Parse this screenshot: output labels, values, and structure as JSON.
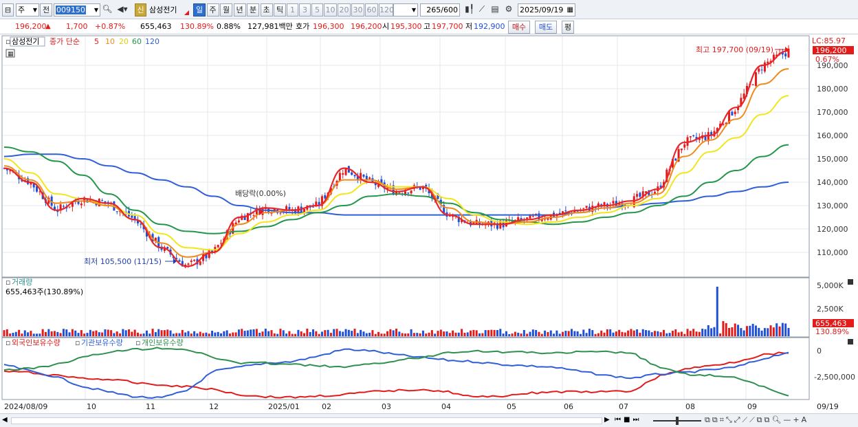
{
  "toolbar": {
    "market_type": "주",
    "prev_label": "전",
    "code": "009150",
    "badge_new": "신",
    "stock_name": "삼성전기",
    "periods": [
      "일",
      "주",
      "월",
      "년",
      "분",
      "초",
      "틱"
    ],
    "active_period": "일",
    "intervals": [
      "1",
      "3",
      "5",
      "10",
      "20",
      "30",
      "60",
      "120"
    ],
    "count": "265",
    "count_max": "/600",
    "date": "2025/09/19"
  },
  "quote": {
    "price": "196,200",
    "arrow": "▲",
    "change": "1,700",
    "change_pct": "+0.87%",
    "volume": "655,463",
    "volume_ratio": "130.89%",
    "turnover": "0.88%",
    "amount": "127,981백만",
    "bid_label": "호가",
    "bid1": "196,300",
    "bid2": "196,200",
    "open_label": "시",
    "open": "195,300",
    "high_label": "고",
    "high": "197,700",
    "low_label": "저",
    "low": "192,900",
    "buy_label": "매수",
    "sell_label": "매도",
    "avg_label": "평"
  },
  "price_panel": {
    "legend_name": "삼성전기",
    "legend_title": "종가 단순",
    "ma_periods": [
      "5",
      "10",
      "20",
      "60",
      "120"
    ],
    "ma_colors": [
      "#e8262a",
      "#f08a1c",
      "#f2e51a",
      "#23964a",
      "#2f5fd8"
    ],
    "lc_label": "LC:85.97",
    "last_price_tag": "196,200",
    "last_pct_tag": "0.67%",
    "high_annotation": "최고 197,700 (09/19)",
    "low_annotation": "최저 105,500 (11/15)",
    "dividend_annotation": "배당락(0.00%)",
    "y_ticks": [
      "190,000",
      "180,000",
      "170,000",
      "160,000",
      "150,000",
      "140,000",
      "130,000",
      "120,000",
      "110,000"
    ]
  },
  "volume_panel": {
    "title": "거래량",
    "current": "655,463주(130.89%)",
    "y_ticks": [
      "5,000K",
      "2,500K"
    ],
    "last_tag": "655,463",
    "ratio_tag": "130.89%"
  },
  "holding_panel": {
    "legends": [
      "외국인보유수량",
      "기관보유수량",
      "개인보유수량"
    ],
    "colors": [
      "#e21b1b",
      "#2f5fd8",
      "#2f8f4e"
    ],
    "y_ticks": [
      "0",
      "-2,500,000"
    ]
  },
  "x_axis": {
    "labels": [
      "2024/08/09",
      "10",
      "11",
      "12",
      "2025/01",
      "02",
      "03",
      "04",
      "05",
      "06",
      "07",
      "08",
      "09"
    ],
    "right_label": "09/19"
  },
  "chart_data": {
    "type": "line",
    "title": "삼성전기",
    "price_ylim": [
      100000,
      200000
    ],
    "months": [
      "2024/08/09",
      "10",
      "11",
      "12",
      "2025/01",
      "02",
      "03",
      "04",
      "05",
      "06",
      "07",
      "08",
      "09",
      "09/19"
    ],
    "series": [
      {
        "name": "5",
        "values": [
          146000,
          140000,
          128000,
          133000,
          131000,
          124000,
          112000,
          104000,
          110000,
          125000,
          129000,
          128000,
          130000,
          146000,
          140000,
          136000,
          138000,
          126000,
          122000,
          122000,
          124000,
          126000,
          128000,
          130000,
          132000,
          137000,
          157000,
          160000,
          172000,
          190000,
          196200
        ]
      },
      {
        "name": "10",
        "values": [
          147000,
          141000,
          131000,
          132000,
          130000,
          124000,
          114000,
          108000,
          110000,
          122000,
          127000,
          128000,
          130000,
          141000,
          141000,
          137000,
          138000,
          129000,
          123000,
          122000,
          123000,
          125000,
          127000,
          129000,
          131000,
          135000,
          151000,
          158000,
          167000,
          182000,
          188500
        ]
      },
      {
        "name": "20",
        "values": [
          150000,
          144000,
          135000,
          133000,
          130000,
          126000,
          118000,
          112000,
          111000,
          118000,
          123000,
          126000,
          128000,
          135000,
          140000,
          138000,
          138000,
          133000,
          126000,
          123000,
          122000,
          123000,
          125000,
          127000,
          130000,
          133000,
          144000,
          153000,
          159000,
          169000,
          177000
        ]
      },
      {
        "name": "60",
        "values": [
          155000,
          153000,
          149000,
          143000,
          135000,
          128000,
          122000,
          119000,
          118000,
          119000,
          121000,
          124000,
          127000,
          130000,
          134000,
          135000,
          134000,
          131000,
          127000,
          124000,
          123000,
          122000,
          123000,
          125000,
          127000,
          130000,
          134000,
          140000,
          145000,
          151000,
          156000
        ]
      },
      {
        "name": "120",
        "values": [
          151000,
          152000,
          152000,
          150000,
          147000,
          144000,
          141000,
          138000,
          134000,
          130000,
          128000,
          127000,
          127000,
          126000,
          126000,
          126000,
          126000,
          126000,
          126000,
          126000,
          126000,
          126000,
          127000,
          129000,
          130000,
          131000,
          132000,
          134000,
          136000,
          138000,
          140000
        ]
      }
    ]
  }
}
